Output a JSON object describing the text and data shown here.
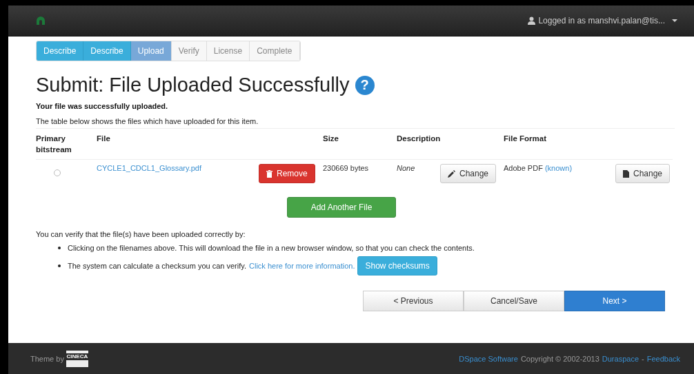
{
  "navbar": {
    "user": "Logged in as manshvi.palan@tis..."
  },
  "steps": [
    {
      "label": "Describe",
      "completed": true,
      "selected": false
    },
    {
      "label": "Describe",
      "completed": true,
      "selected": false
    },
    {
      "label": "Upload",
      "completed": false,
      "selected": true
    },
    {
      "label": "Verify",
      "completed": false,
      "selected": false
    },
    {
      "label": "License",
      "completed": false,
      "selected": false
    },
    {
      "label": "Complete",
      "completed": false,
      "selected": false
    }
  ],
  "title": "Submit: File Uploaded Successfully",
  "help_icon": "?",
  "success_message": "Your file was successfully uploaded.",
  "table_caption": "The table below shows the files which have uploaded for this item.",
  "table": {
    "columns": [
      "Primary bitstream",
      "File",
      "Size",
      "Description",
      "File Format"
    ],
    "rows": [
      {
        "selected": false,
        "file": "CYCLE1_CDCL1_Glossary.pdf",
        "remove": "Remove",
        "size": "230669 bytes",
        "description": "None",
        "description_button": "Change",
        "format": "Adobe PDF",
        "format_note": "(known)",
        "format_button": "Change"
      }
    ]
  },
  "add_button": "Add Another File",
  "verify_intro": "You can verify that the file(s) have been uploaded correctly by:",
  "bullets": [
    {
      "text": "Clicking on the filenames above. This will download the file in a new browser window, so that you can check the contents."
    },
    {
      "text": "The system can calculate a checksum you can verify.",
      "link": "Click here for more information.",
      "button": "Show checksums"
    }
  ],
  "nav_buttons": [
    {
      "label": "< Previous",
      "kind": "default"
    },
    {
      "label": "Cancel/Save",
      "kind": "default"
    },
    {
      "label": "Next >",
      "kind": "primary"
    }
  ],
  "footer": {
    "theme_by": "Theme by",
    "logo_text": "CINECA",
    "links": [
      {
        "label": "DSpace Software",
        "kind": "link"
      },
      {
        "label": "Copyright © 2002-2013",
        "kind": "text"
      },
      {
        "label": "Duraspace",
        "kind": "link"
      },
      {
        "label": "-",
        "kind": "text"
      },
      {
        "label": "Feedback",
        "kind": "link"
      }
    ]
  }
}
